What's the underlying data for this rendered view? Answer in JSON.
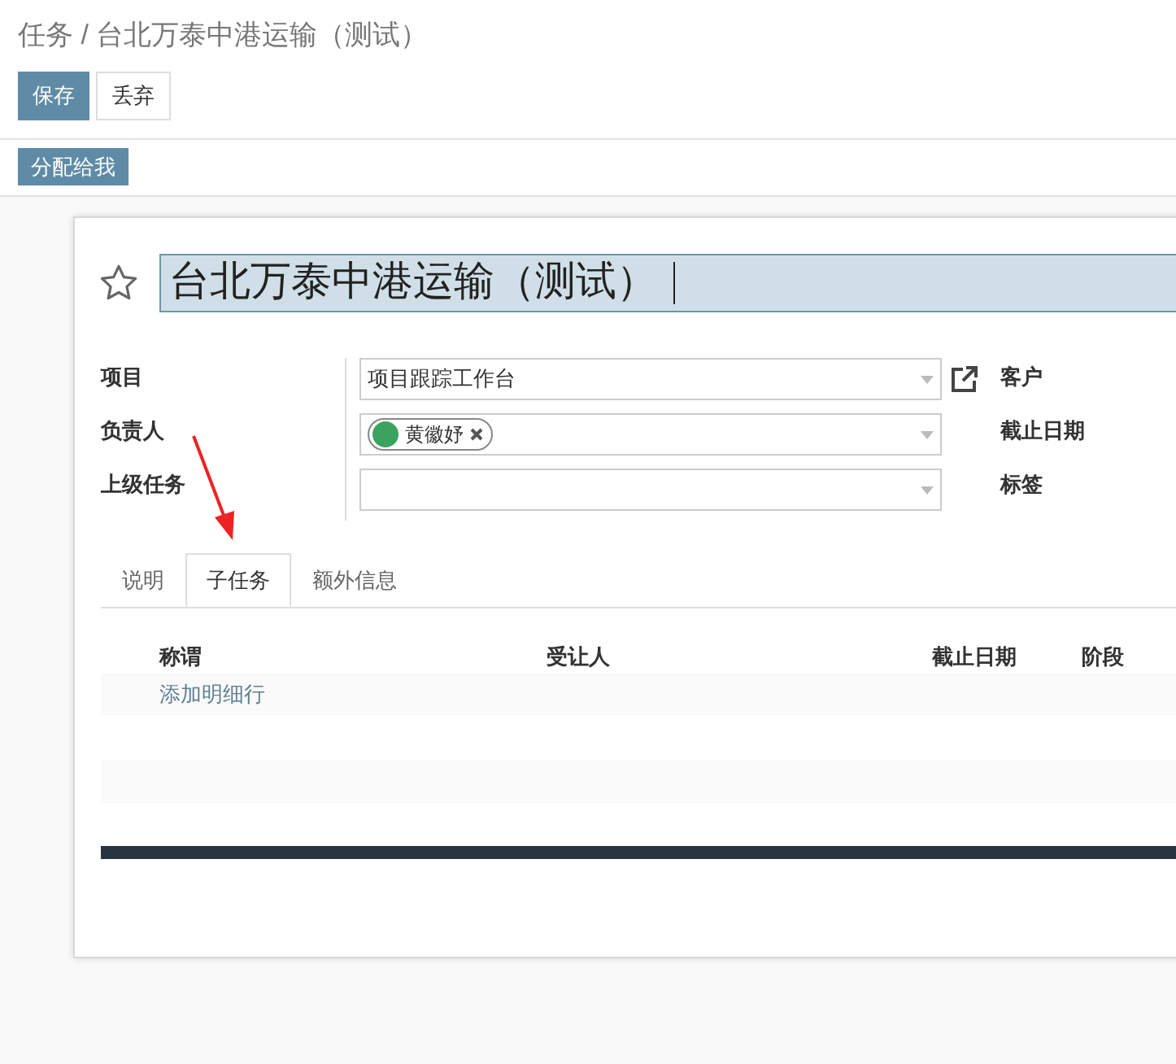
{
  "breadcrumb": "任务 / 台北万泰中港运输（测试）",
  "buttons": [
    {
      "label": "保存",
      "kind": "primary"
    },
    {
      "label": "丢弃",
      "kind": "secondary"
    }
  ],
  "status_button": "分配给我",
  "form": {
    "starred": false,
    "title": "台北万泰中港运输（测试）",
    "fields_left": [
      {
        "label": "项目",
        "kind": "select",
        "value": "项目跟踪工作台",
        "external_link": true
      },
      {
        "label": "负责人",
        "kind": "tags",
        "tags": [
          "黄徽妤"
        ],
        "external_link": false
      },
      {
        "label": "上级任务",
        "kind": "select",
        "external_link": false
      }
    ],
    "fields_right": [
      {
        "label": "客户"
      },
      {
        "label": "截止日期"
      },
      {
        "label": "标签"
      }
    ],
    "tabs": [
      {
        "label": "说明",
        "selected": false
      },
      {
        "label": "子任务",
        "selected": true
      },
      {
        "label": "额外信息",
        "selected": false
      }
    ],
    "table": {
      "columns": [
        "称谓",
        "受让人",
        "截止日期",
        "阶段"
      ],
      "add_line": "添加明细行"
    }
  }
}
